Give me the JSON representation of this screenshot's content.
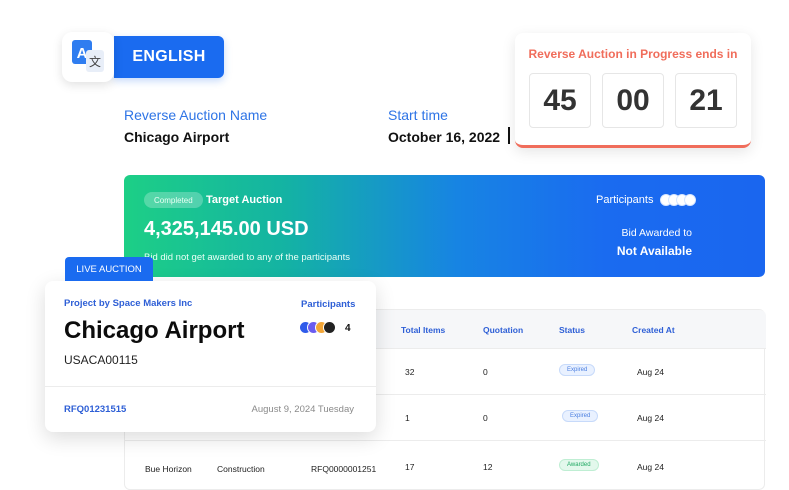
{
  "language": {
    "icon": "translate-icon",
    "label": "ENGLISH"
  },
  "auction": {
    "name_label": "Reverse Auction Name",
    "name_value": "Chicago Airport",
    "start_label": "Start time",
    "start_value": "October 16, 2022"
  },
  "countdown": {
    "title": "Reverse Auction in Progress ends in",
    "hours": "45",
    "minutes": "00",
    "seconds": "21",
    "accent_color": "#f06d5b"
  },
  "banner": {
    "status_badge": "Completed",
    "target_label": "Target Auction",
    "amount": "4,325,145.00 USD",
    "subtext": "Bid did not get awarded to any of the participants",
    "participants_label": "Participants",
    "awarded_label": "Bid Awarded to",
    "awarded_value": "Not Available",
    "gradient_colors": [
      "#1dcf86",
      "#1a6bf0"
    ]
  },
  "table": {
    "headers": [
      "Total Items",
      "Quotation",
      "Status",
      "Created At"
    ],
    "rows": [
      {
        "name": "",
        "category": "",
        "rfq": "",
        "total_items": "32",
        "quotation": "0",
        "status": "Expired",
        "created_at": "Aug 24"
      },
      {
        "name": "",
        "category": "",
        "rfq": "",
        "total_items": "1",
        "quotation": "0",
        "status": "Expired",
        "created_at": "Aug 24"
      },
      {
        "name": "Bue Horizon",
        "category": "Construction",
        "rfq": "RFQ0000001251",
        "total_items": "17",
        "quotation": "12",
        "status": "Awarded",
        "created_at": "Aug 24"
      }
    ]
  },
  "live_card": {
    "badge": "LIVE AUCTION",
    "project": "Project by Space Makers Inc",
    "title": "Chicago Airport",
    "code": "USACA00115",
    "participants_label": "Participants",
    "participants_count": "4",
    "participant_colors": [
      "#2f5bea",
      "#6a5cf0",
      "#f2a536",
      "#222222"
    ],
    "rfq": "RFQ01231515",
    "date": "August 9, 2024 Tuesday"
  },
  "brand_color": "#1a6bf0"
}
